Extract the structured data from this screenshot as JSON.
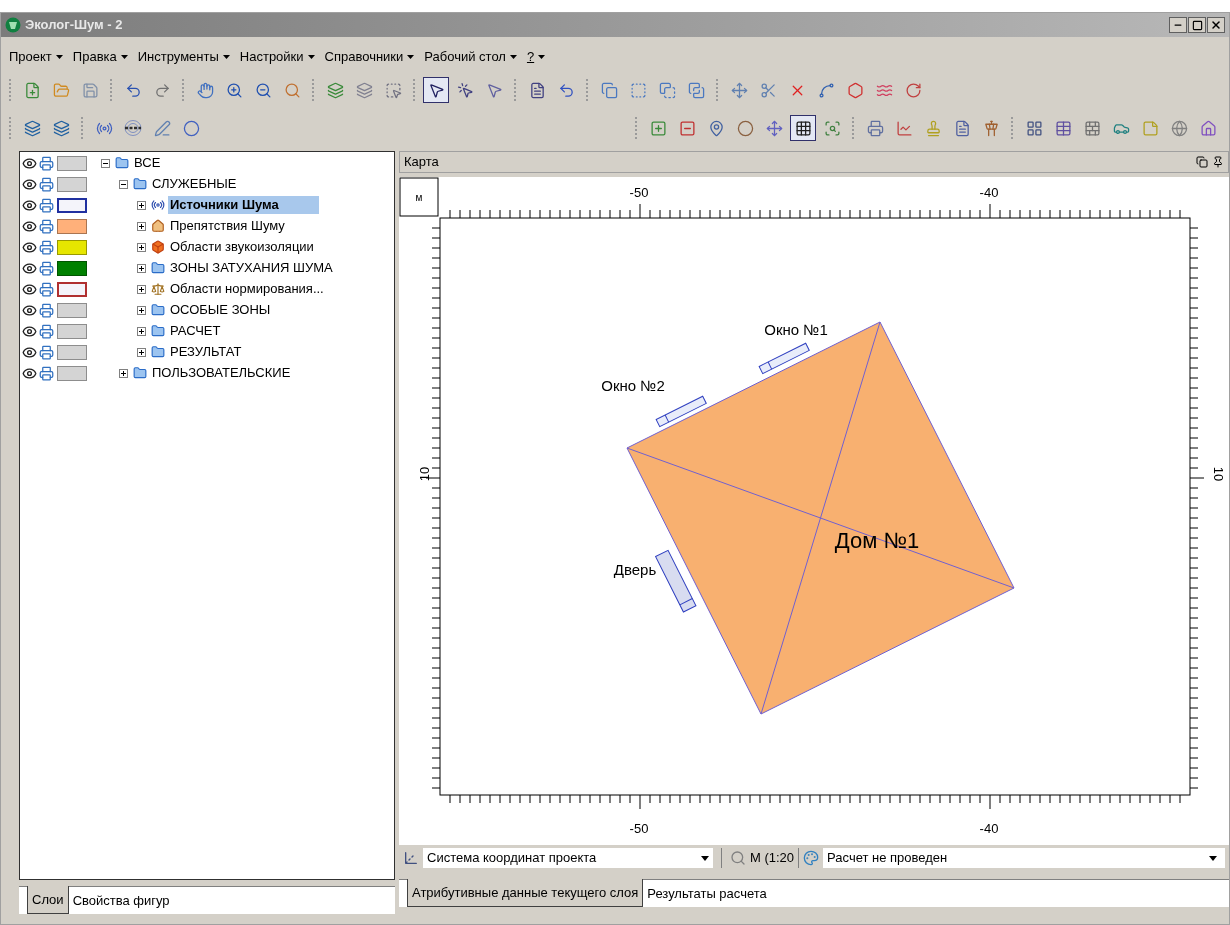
{
  "window": {
    "title": "Эколог-Шум - 2"
  },
  "menu": [
    "Проект",
    "Правка",
    "Инструменты",
    "Настройки",
    "Справочники",
    "Рабочий стол",
    "?"
  ],
  "toolbar_1": [
    {
      "kind": "new",
      "selected": false
    },
    {
      "kind": "open",
      "selected": false
    },
    {
      "kind": "save",
      "selected": false
    },
    {
      "kind": "sep"
    },
    {
      "kind": "undo",
      "selected": false
    },
    {
      "kind": "redo",
      "selected": false
    },
    {
      "kind": "sep"
    },
    {
      "kind": "pan",
      "selected": false
    },
    {
      "kind": "zoom_in",
      "selected": false
    },
    {
      "kind": "zoom_out",
      "selected": false
    },
    {
      "kind": "zoom_page",
      "selected": false
    },
    {
      "kind": "sep"
    },
    {
      "kind": "layer_add",
      "selected": false
    },
    {
      "kind": "layer_check",
      "selected": false
    },
    {
      "kind": "layer_pick",
      "selected": false
    },
    {
      "kind": "sep"
    },
    {
      "kind": "pointer",
      "selected": true
    },
    {
      "kind": "pointer_add",
      "selected": false
    },
    {
      "kind": "pointer_sub",
      "selected": false
    },
    {
      "kind": "sep"
    },
    {
      "kind": "pointer_doc",
      "selected": false
    },
    {
      "kind": "pointer_back",
      "selected": false
    },
    {
      "kind": "sep"
    },
    {
      "kind": "union",
      "selected": false
    },
    {
      "kind": "intersect",
      "selected": false
    },
    {
      "kind": "subtract",
      "selected": false
    },
    {
      "kind": "exclude",
      "selected": false
    },
    {
      "kind": "sep"
    },
    {
      "kind": "move",
      "selected": false
    },
    {
      "kind": "split",
      "selected": false
    },
    {
      "kind": "delete",
      "selected": false
    },
    {
      "kind": "nodes",
      "selected": false
    },
    {
      "kind": "polygon",
      "selected": false
    },
    {
      "kind": "curve",
      "selected": false
    },
    {
      "kind": "rotate",
      "selected": false
    }
  ],
  "toolbar_2_left": [
    {
      "kind": "layers_add",
      "selected": false
    },
    {
      "kind": "layers",
      "selected": false
    },
    {
      "kind": "sep"
    },
    {
      "kind": "point_source",
      "selected": false
    },
    {
      "kind": "line_source",
      "selected": false
    },
    {
      "kind": "edit_source",
      "selected": false
    },
    {
      "kind": "area_source",
      "selected": false
    }
  ],
  "toolbar_2_right": [
    {
      "kind": "calc_add",
      "selected": false
    },
    {
      "kind": "calc_remove",
      "selected": false
    },
    {
      "kind": "calc_point",
      "selected": false
    },
    {
      "kind": "calc_dot",
      "selected": false
    },
    {
      "kind": "calc_move",
      "selected": false
    },
    {
      "kind": "calc_grid",
      "selected": true
    },
    {
      "kind": "find",
      "selected": false
    },
    {
      "kind": "sep"
    },
    {
      "kind": "print",
      "selected": false
    },
    {
      "kind": "chart",
      "selected": false
    },
    {
      "kind": "stamp",
      "selected": false
    },
    {
      "kind": "doc",
      "selected": false
    },
    {
      "kind": "tower",
      "selected": false
    },
    {
      "kind": "sep"
    },
    {
      "kind": "grid_map",
      "selected": false
    },
    {
      "kind": "table",
      "selected": false
    },
    {
      "kind": "wall",
      "selected": false
    },
    {
      "kind": "car",
      "selected": false
    },
    {
      "kind": "note",
      "selected": false
    },
    {
      "kind": "globe",
      "selected": false
    },
    {
      "kind": "home",
      "selected": false
    }
  ],
  "layers": [
    {
      "label": "ВСЕ",
      "kind": "folder",
      "swatch": {
        "kind": "fill",
        "color": "#d4d4d4"
      },
      "expanded": true,
      "selected": false,
      "children": [
        {
          "label": "СЛУЖЕБНЫЕ",
          "kind": "folder",
          "swatch": {
            "kind": "fill",
            "color": "#d4d4d4"
          },
          "expanded": true,
          "selected": false,
          "children": [
            {
              "label": "Источники Шума",
              "kind": "source",
              "swatch": {
                "kind": "outline",
                "color": "#2030a0"
              },
              "expanded": false,
              "selected": true
            },
            {
              "label": "Препятствия Шуму",
              "kind": "house",
              "swatch": {
                "kind": "fill",
                "color": "#ffb07a"
              },
              "expanded": false,
              "selected": false
            },
            {
              "label": "Области звукоизоляции",
              "kind": "brick",
              "swatch": {
                "kind": "fill",
                "color": "#e6e600"
              },
              "expanded": false,
              "selected": false
            },
            {
              "label": "ЗОНЫ ЗАТУХАНИЯ ШУМА",
              "kind": "folder",
              "swatch": {
                "kind": "fill",
                "color": "#008000"
              },
              "expanded": false,
              "selected": false
            },
            {
              "label": "Области нормирования...",
              "kind": "scale",
              "swatch": {
                "kind": "outline",
                "color": "#b03030"
              },
              "expanded": false,
              "selected": false
            },
            {
              "label": "ОСОБЫЕ ЗОНЫ",
              "kind": "folder",
              "swatch": {
                "kind": "fill",
                "color": "#d4d4d4"
              },
              "expanded": false,
              "selected": false
            },
            {
              "label": "РАСЧЕТ",
              "kind": "folder",
              "swatch": {
                "kind": "fill",
                "color": "#d4d4d4"
              },
              "expanded": false,
              "selected": false
            },
            {
              "label": "РЕЗУЛЬТАТ",
              "kind": "folder",
              "swatch": {
                "kind": "fill",
                "color": "#d4d4d4"
              },
              "expanded": false,
              "selected": false
            }
          ]
        },
        {
          "label": "ПОЛЬЗОВАТЕЛЬСКИЕ",
          "kind": "folder",
          "swatch": {
            "kind": "fill",
            "color": "#d4d4d4"
          },
          "expanded": false,
          "selected": false
        }
      ]
    }
  ],
  "left_tabs": [
    {
      "label": "Слои",
      "selected": true
    },
    {
      "label": "Свойства фигур",
      "selected": false
    }
  ],
  "map": {
    "title": "Карта",
    "unit": "м",
    "top_labels": [
      "-50",
      "-40"
    ],
    "bottom_labels": [
      "-50",
      "-40"
    ],
    "left_label": "10",
    "right_label": "10",
    "building": {
      "label": "Дом №1"
    },
    "openings": [
      {
        "kind": "window",
        "label": "Окно №1"
      },
      {
        "kind": "window",
        "label": "Окно №2"
      },
      {
        "kind": "door",
        "label": "Дверь"
      }
    ]
  },
  "status_bar": {
    "coordinate_system": "Система координат проекта",
    "scale": "М (1:20",
    "calculation": "Расчет не проведен"
  },
  "bottom_tabs": [
    {
      "label": "Атрибутивные данные текущего слоя",
      "selected": true
    },
    {
      "label": "Результаты расчета",
      "selected": false
    }
  ]
}
